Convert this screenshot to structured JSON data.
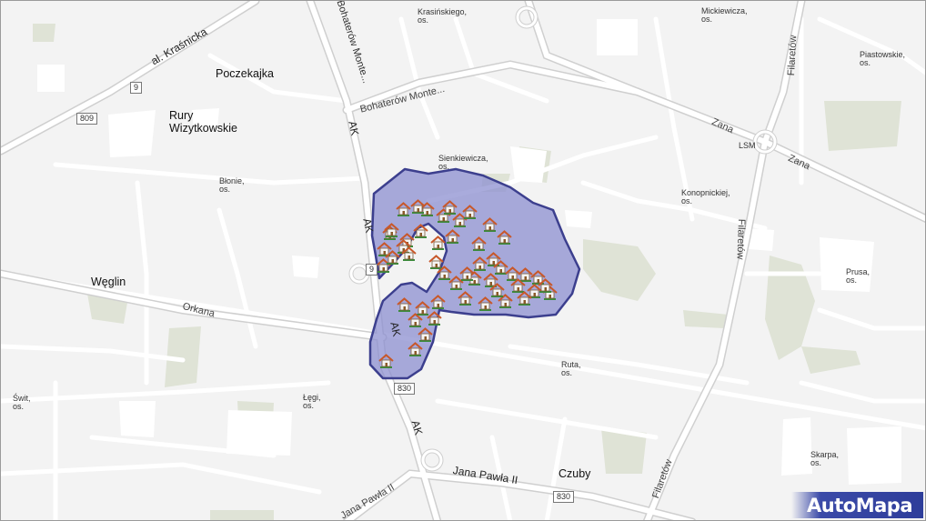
{
  "map": {
    "provider": "AutoMapa",
    "place_labels": [
      {
        "id": "poczekajka",
        "text": "Poczekajka"
      },
      {
        "id": "rury-wiz",
        "line1": "Rury",
        "line2": "Wizytkowskie"
      },
      {
        "id": "weglin",
        "text": "Węglin"
      },
      {
        "id": "czuby",
        "text": "Czuby"
      }
    ],
    "district_labels": [
      {
        "id": "krasinskiego",
        "line1": "Krasińskiego,",
        "line2": "os."
      },
      {
        "id": "mickiewicza",
        "line1": "Mickiewicza,",
        "line2": "os."
      },
      {
        "id": "piastowskie",
        "line1": "Piastowskie,",
        "line2": "os."
      },
      {
        "id": "sienkiewicza",
        "line1": "Sienkiewicza,",
        "line2": "os."
      },
      {
        "id": "blonie",
        "line1": "Błonie,",
        "line2": "os."
      },
      {
        "id": "konopnickiej",
        "line1": "Konopnickiej,",
        "line2": "os."
      },
      {
        "id": "prusa",
        "line1": "Prusa,",
        "line2": "os."
      },
      {
        "id": "ruta",
        "line1": "Ruta,",
        "line2": "os."
      },
      {
        "id": "swit",
        "line1": "Świt,",
        "line2": "os."
      },
      {
        "id": "legi",
        "line1": "Łęgi,",
        "line2": "os."
      },
      {
        "id": "skarpa",
        "line1": "Skarpa,",
        "line2": "os."
      }
    ],
    "road_labels": {
      "al_krasnicka": "al. Kraśnicka",
      "bohaterow_monte_vertical": "Bohaterów Monte...",
      "bohaterow_monte": "Bohaterów Monte...",
      "ak_north": "AK",
      "ak_mid": "AK",
      "ak_south": "AK",
      "ak_bottom": "AK",
      "zana_1": "Zana",
      "zana_2": "Zana",
      "lsm": "LSM",
      "filaretow_1": "Filaretów",
      "filaretow_2": "Filaretów",
      "filaretow_3": "Filaretów",
      "orkana": "Orkana",
      "jana_pawla_1": "Jana Pawła II",
      "jana_pawla_2": "Jana Pawła II"
    },
    "shields": {
      "s809": "809",
      "s830_a": "830",
      "s830_b": "830",
      "s_small_1": "9",
      "s_small_2": "9"
    },
    "highlight_area": {
      "fill": "#8c8fd0",
      "stroke": "#3c3f8e",
      "house_icon_count": 50
    }
  }
}
